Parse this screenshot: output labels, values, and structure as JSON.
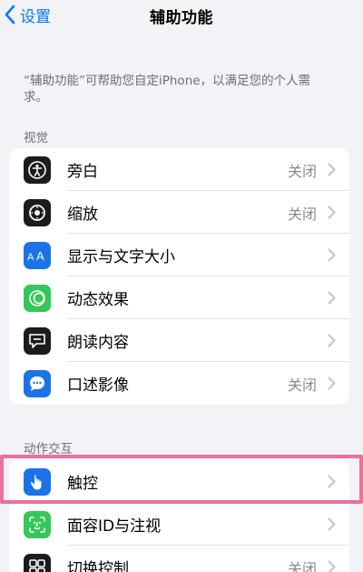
{
  "nav": {
    "back_label": "设置",
    "title": "辅助功能"
  },
  "description": "“辅助功能”可帮助您自定iPhone，以满足您的个人需求。",
  "sections": {
    "vision": {
      "header": "视觉",
      "items": [
        {
          "label": "旁白",
          "value": "关闭",
          "icon": "voiceover-icon",
          "color": "#1c1c1e"
        },
        {
          "label": "缩放",
          "value": "关闭",
          "icon": "zoom-icon",
          "color": "#1c1c1e"
        },
        {
          "label": "显示与文字大小",
          "value": "",
          "icon": "text-size-icon",
          "color": "#1a73e8"
        },
        {
          "label": "动态效果",
          "value": "",
          "icon": "motion-icon",
          "color": "#34c759"
        },
        {
          "label": "朗读内容",
          "value": "",
          "icon": "spoken-content-icon",
          "color": "#1c1c1e"
        },
        {
          "label": "口述影像",
          "value": "关闭",
          "icon": "audio-description-icon",
          "color": "#1a73e8"
        }
      ]
    },
    "interaction": {
      "header": "动作交互",
      "items": [
        {
          "label": "触控",
          "value": "",
          "icon": "touch-icon",
          "color": "#1a73e8"
        },
        {
          "label": "面容ID与注视",
          "value": "",
          "icon": "face-id-icon",
          "color": "#34c759"
        },
        {
          "label": "切换控制",
          "value": "关闭",
          "icon": "switch-control-icon",
          "color": "#1c1c1e"
        }
      ]
    }
  }
}
